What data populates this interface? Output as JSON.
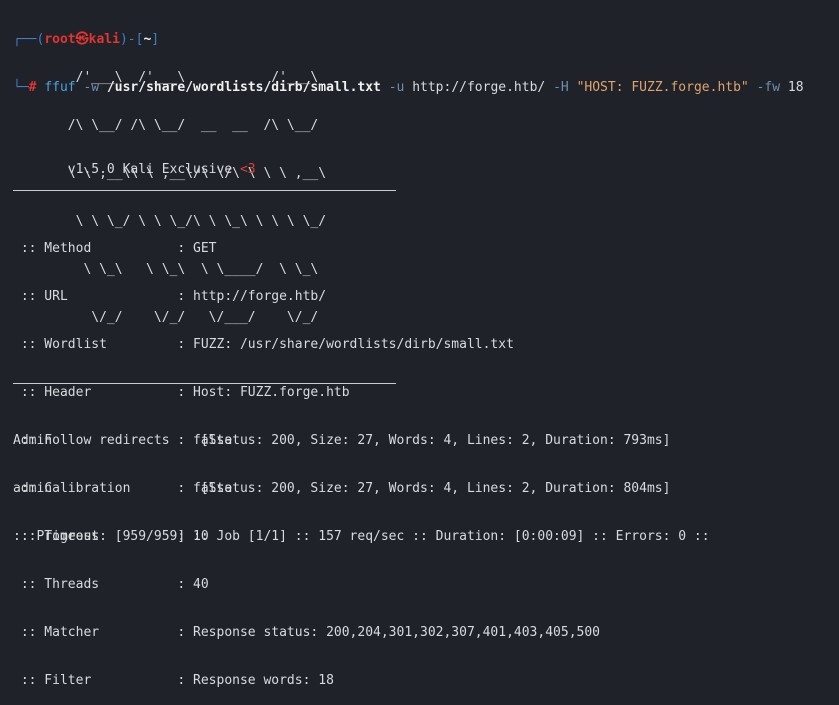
{
  "prompt": {
    "box_top": "┌──(",
    "user": "root",
    "at_symbol": "㉿",
    "host": "kali",
    "mid": ")-[",
    "dir": "~",
    "end": "]",
    "box_bottom": "└─",
    "hash": "#"
  },
  "command": {
    "program": "ffuf",
    "flag_w": "-w",
    "wordlist": "/usr/share/wordlists/dirb/small.txt",
    "flag_u": "-u",
    "url": "http://forge.htb/",
    "flag_h": "-H",
    "header": "\"HOST: FUZZ.forge.htb\"",
    "flag_fw": "-fw",
    "fw_value": "18"
  },
  "banner": [
    "        /'___\\  /'___\\           /'___\\",
    "       /\\ \\__/ /\\ \\__/  __  __  /\\ \\__/",
    "       \\ \\ ,__\\\\ \\ ,__\\/\\ \\/\\ \\ \\ \\ ,__\\",
    "        \\ \\ \\_/ \\ \\ \\_/\\ \\ \\_\\ \\ \\ \\ \\_/",
    "         \\ \\_\\   \\ \\_\\  \\ \\____/  \\ \\_\\",
    "          \\/_/    \\/_/   \\/___/    \\/_/"
  ],
  "version": {
    "text": "       v1.5.0 Kali Exclusive ",
    "heart": "<3"
  },
  "config": [
    " :: Method           : GET",
    " :: URL              : http://forge.htb/",
    " :: Wordlist         : FUZZ: /usr/share/wordlists/dirb/small.txt",
    " :: Header           : Host: FUZZ.forge.htb",
    " :: Follow redirects : false",
    " :: Calibration      : false",
    " :: Timeout          : 10",
    " :: Threads          : 40",
    " :: Matcher          : Response status: 200,204,301,302,307,401,403,405,500",
    " :: Filter           : Response words: 18"
  ],
  "results": [
    "Admin                   [Status: 200, Size: 27, Words: 4, Lines: 2, Duration: 793ms]",
    "admin                   [Status: 200, Size: 27, Words: 4, Lines: 2, Duration: 804ms]"
  ],
  "progress": ":: Progress: [959/959] :: Job [1/1] :: 157 req/sec :: Duration: [0:00:09] :: Errors: 0 ::",
  "colors": {
    "background": "#1f2229",
    "prompt_box": "#3f7fc4",
    "prompt_user": "#e3342f",
    "string": "#e0a36b"
  }
}
